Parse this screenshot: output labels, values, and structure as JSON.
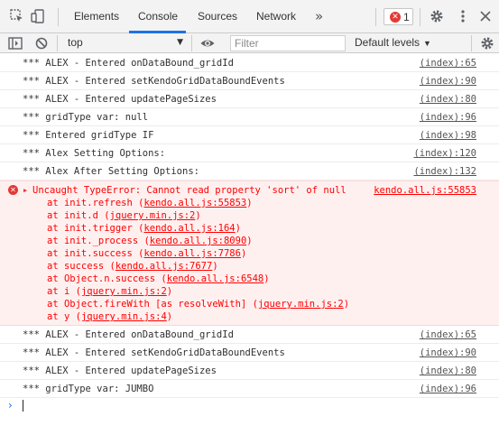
{
  "tabs": [
    {
      "label": "Elements"
    },
    {
      "label": "Console"
    },
    {
      "label": "Sources"
    },
    {
      "label": "Network"
    }
  ],
  "active_tab": "Console",
  "more_tabs_label": "»",
  "error_count": "1",
  "toolbar": {
    "context": "top",
    "filter_placeholder": "Filter",
    "levels_label": "Default levels"
  },
  "icons": {
    "inspect": "inspect-element-icon",
    "device": "device-toolbar-icon",
    "sidebar": "show-console-sidebar-icon",
    "clear": "clear-console-icon",
    "eye": "live-expression-icon",
    "gear": "settings-gear-icon",
    "kebab": "more-options-icon"
  },
  "messages_before": [
    {
      "text": "*** ALEX - Entered onDataBound_gridId",
      "source": "(index):65"
    },
    {
      "text": "*** ALEX - Entered setKendoGridDataBoundEvents",
      "source": "(index):90"
    },
    {
      "text": "*** ALEX - Entered updatePageSizes",
      "source": "(index):80"
    },
    {
      "text": "*** gridType var: null",
      "source": "(index):96"
    },
    {
      "text": "*** Entered gridType IF",
      "source": "(index):98"
    },
    {
      "text": "*** Alex Setting Options:",
      "source": "(index):120"
    },
    {
      "text": "*** Alex After Setting Options:",
      "source": "(index):132"
    }
  ],
  "error": {
    "head": "Uncaught TypeError: Cannot read property 'sort' of null",
    "source": "kendo.all.js:55853",
    "stack": [
      {
        "fn": "at init.refresh (",
        "loc": "kendo.all.js:55853",
        "tail": ")"
      },
      {
        "fn": "at init.d (",
        "loc": "jquery.min.js:2",
        "tail": ")"
      },
      {
        "fn": "at init.trigger (",
        "loc": "kendo.all.js:164",
        "tail": ")"
      },
      {
        "fn": "at init._process (",
        "loc": "kendo.all.js:8090",
        "tail": ")"
      },
      {
        "fn": "at init.success (",
        "loc": "kendo.all.js:7786",
        "tail": ")"
      },
      {
        "fn": "at success (",
        "loc": "kendo.all.js:7677",
        "tail": ")"
      },
      {
        "fn": "at Object.n.success (",
        "loc": "kendo.all.js:6548",
        "tail": ")"
      },
      {
        "fn": "at i (",
        "loc": "jquery.min.js:2",
        "tail": ")"
      },
      {
        "fn": "at Object.fireWith [as resolveWith] (",
        "loc": "jquery.min.js:2",
        "tail": ")"
      },
      {
        "fn": "at y (",
        "loc": "jquery.min.js:4",
        "tail": ")"
      }
    ]
  },
  "messages_after": [
    {
      "text": "*** ALEX - Entered onDataBound_gridId",
      "source": "(index):65"
    },
    {
      "text": "*** ALEX - Entered setKendoGridDataBoundEvents",
      "source": "(index):90"
    },
    {
      "text": "*** ALEX - Entered updatePageSizes",
      "source": "(index):80"
    },
    {
      "text": "*** gridType var: JUMBO",
      "source": "(index):96"
    }
  ],
  "prompt_symbol": "›",
  "colors": {
    "accent": "#1a73e8",
    "error_red": "#ff0000",
    "error_bg": "#fff0f0"
  }
}
